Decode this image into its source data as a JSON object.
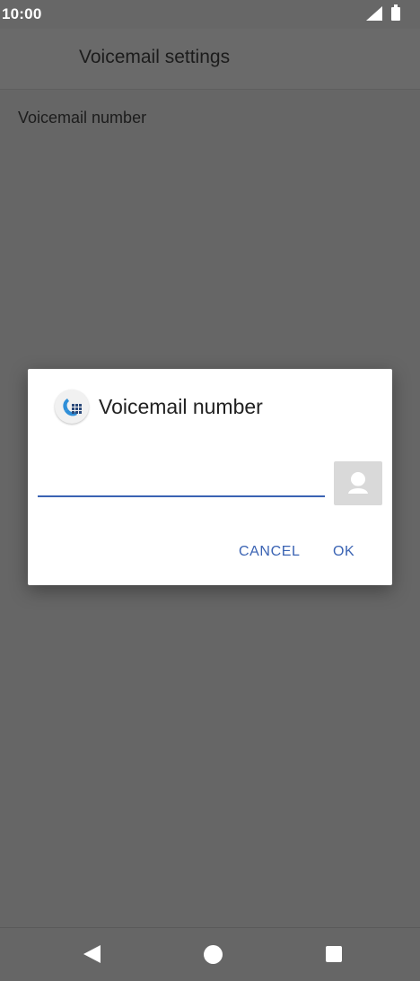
{
  "status_bar": {
    "time": "10:00",
    "icons": [
      "signal-icon",
      "battery-icon"
    ]
  },
  "toolbar": {
    "title": "Voicemail settings"
  },
  "preferences": {
    "items": [
      {
        "title": "Voicemail number"
      }
    ]
  },
  "dialog": {
    "icon": "phone-dialer-icon",
    "title": "Voicemail number",
    "input": {
      "value": "",
      "placeholder": ""
    },
    "contact_button_icon": "contact-picker-icon",
    "cancel_label": "CANCEL",
    "ok_label": "OK"
  },
  "nav_bar": {
    "icons": [
      "back-icon",
      "home-icon",
      "recents-icon"
    ]
  },
  "colors": {
    "accent": "#3a63b3",
    "scrim_background": "#666666",
    "dialog_background": "#ffffff"
  }
}
